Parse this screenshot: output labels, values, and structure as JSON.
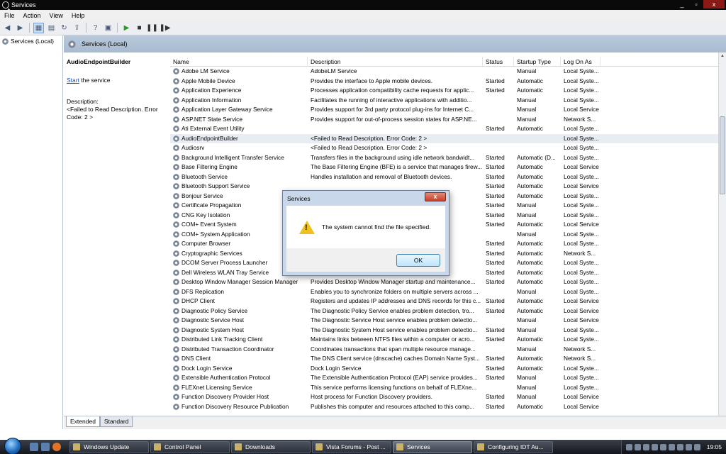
{
  "window": {
    "title": "Services",
    "controls": [
      "_",
      "▫",
      "x"
    ]
  },
  "menu": [
    "File",
    "Action",
    "View",
    "Help"
  ],
  "toolbar_icons": [
    "back-icon",
    "forward-icon",
    "console-tree-icon",
    "properties-icon",
    "refresh-icon",
    "export-icon",
    "help-icon",
    "console-icon",
    "play-icon",
    "stop-icon",
    "pause-icon",
    "restart-icon"
  ],
  "tree": {
    "root_label": "Services (Local)"
  },
  "panel": {
    "header": "Services (Local)"
  },
  "details": {
    "service_name": "AudioEndpointBuilder",
    "start_link": "Start",
    "start_suffix": " the service",
    "description_label": "Description:",
    "description_text": "<Failed to Read Description. Error Code: 2 >"
  },
  "columns": [
    "Name",
    "Description",
    "Status",
    "Startup Type",
    "Log On As"
  ],
  "services": [
    {
      "name": "Adobe LM Service",
      "desc": "AdobeLM Service",
      "status": "",
      "startup": "Manual",
      "logon": "Local Syste..."
    },
    {
      "name": "Apple Mobile Device",
      "desc": "Provides the interface to Apple mobile devices.",
      "status": "Started",
      "startup": "Automatic",
      "logon": "Local Syste..."
    },
    {
      "name": "Application Experience",
      "desc": "Processes application compatibility cache requests for applic...",
      "status": "Started",
      "startup": "Automatic",
      "logon": "Local Syste..."
    },
    {
      "name": "Application Information",
      "desc": "Facilitates the running of interactive applications with additio...",
      "status": "",
      "startup": "Manual",
      "logon": "Local Syste..."
    },
    {
      "name": "Application Layer Gateway Service",
      "desc": "Provides support for 3rd party protocol plug-ins for Internet C...",
      "status": "",
      "startup": "Manual",
      "logon": "Local Service"
    },
    {
      "name": "ASP.NET State Service",
      "desc": "Provides support for out-of-process session states for ASP.NE...",
      "status": "",
      "startup": "Manual",
      "logon": "Network S..."
    },
    {
      "name": "Ati External Event Utility",
      "desc": "",
      "status": "Started",
      "startup": "Automatic",
      "logon": "Local Syste..."
    },
    {
      "name": "AudioEndpointBuilder",
      "desc": "<Failed to Read Description. Error Code: 2 >",
      "status": "",
      "startup": "",
      "logon": "Local Syste..."
    },
    {
      "name": "Audiosrv",
      "desc": "<Failed to Read Description. Error Code: 2 >",
      "status": "",
      "startup": "",
      "logon": "Local Syste..."
    },
    {
      "name": "Background Intelligent Transfer Service",
      "desc": "Transfers files in the background using idle network bandwidt...",
      "status": "Started",
      "startup": "Automatic (D...",
      "logon": "Local Syste..."
    },
    {
      "name": "Base Filtering Engine",
      "desc": "The Base Filtering Engine (BFE) is a service that manages firew...",
      "status": "Started",
      "startup": "Automatic",
      "logon": "Local Service"
    },
    {
      "name": "Bluetooth Service",
      "desc": "Handles installation and removal of Bluetooth devices.",
      "status": "Started",
      "startup": "Automatic",
      "logon": "Local Syste..."
    },
    {
      "name": "Bluetooth Support Service",
      "desc": "",
      "status": "Started",
      "startup": "Automatic",
      "logon": "Local Service"
    },
    {
      "name": "Bonjour Service",
      "desc": "dvertise...",
      "status": "Started",
      "startup": "Automatic",
      "logon": "Local Syste..."
    },
    {
      "name": "Certificate Propagation",
      "desc": "",
      "status": "Started",
      "startup": "Manual",
      "logon": "Local Syste..."
    },
    {
      "name": "CNG Key Isolation",
      "desc": "ocess. Th...",
      "status": "Started",
      "startup": "Manual",
      "logon": "Local Syste..."
    },
    {
      "name": "COM+ Event System",
      "desc": "hich pro...",
      "status": "Started",
      "startup": "Automatic",
      "logon": "Local Service"
    },
    {
      "name": "COM+ System Application",
      "desc": "ent Obje...",
      "status": "",
      "startup": "Manual",
      "logon": "Local Syste..."
    },
    {
      "name": "Computer Browser",
      "desc": "rk and s...",
      "status": "Started",
      "startup": "Automatic",
      "logon": "Local Syste..."
    },
    {
      "name": "Cryptographic Services",
      "desc": "e Servic...",
      "status": "Started",
      "startup": "Automatic",
      "logon": "Network S..."
    },
    {
      "name": "DCOM Server Process Launcher",
      "desc": "",
      "status": "Started",
      "startup": "Automatic",
      "logon": "Local Syste..."
    },
    {
      "name": "Dell Wireless WLAN Tray Service",
      "desc": "er usin...",
      "status": "Started",
      "startup": "Automatic",
      "logon": "Local Syste..."
    },
    {
      "name": "Desktop Window Manager Session Manager",
      "desc": "Provides Desktop Window Manager startup and maintenance...",
      "status": "Started",
      "startup": "Automatic",
      "logon": "Local Syste..."
    },
    {
      "name": "DFS Replication",
      "desc": "Enables you to synchronize folders on multiple servers across ...",
      "status": "",
      "startup": "Manual",
      "logon": "Local Syste..."
    },
    {
      "name": "DHCP Client",
      "desc": "Registers and updates IP addresses and DNS records for this c...",
      "status": "Started",
      "startup": "Automatic",
      "logon": "Local Service"
    },
    {
      "name": "Diagnostic Policy Service",
      "desc": "The Diagnostic Policy Service enables problem detection, tro...",
      "status": "Started",
      "startup": "Automatic",
      "logon": "Local Service"
    },
    {
      "name": "Diagnostic Service Host",
      "desc": "The Diagnostic Service Host service enables problem detectio...",
      "status": "",
      "startup": "Manual",
      "logon": "Local Service"
    },
    {
      "name": "Diagnostic System Host",
      "desc": "The Diagnostic System Host service enables problem detectio...",
      "status": "Started",
      "startup": "Manual",
      "logon": "Local Syste..."
    },
    {
      "name": "Distributed Link Tracking Client",
      "desc": "Maintains links between NTFS files within a computer or acro...",
      "status": "Started",
      "startup": "Automatic",
      "logon": "Local Syste..."
    },
    {
      "name": "Distributed Transaction Coordinator",
      "desc": "Coordinates transactions that span multiple resource manage...",
      "status": "",
      "startup": "Manual",
      "logon": "Network S..."
    },
    {
      "name": "DNS Client",
      "desc": "The DNS Client service (dnscache) caches Domain Name Syst...",
      "status": "Started",
      "startup": "Automatic",
      "logon": "Network S..."
    },
    {
      "name": "Dock Login Service",
      "desc": "Dock Login Service",
      "status": "Started",
      "startup": "Automatic",
      "logon": "Local Syste..."
    },
    {
      "name": "Extensible Authentication Protocol",
      "desc": "The Extensible Authentication Protocol (EAP) service provides...",
      "status": "Started",
      "startup": "Manual",
      "logon": "Local Syste..."
    },
    {
      "name": "FLEXnet Licensing Service",
      "desc": "This service performs licensing functions on behalf of FLEXne...",
      "status": "",
      "startup": "Manual",
      "logon": "Local Syste..."
    },
    {
      "name": "Function Discovery Provider Host",
      "desc": "Host process for Function Discovery providers.",
      "status": "Started",
      "startup": "Manual",
      "logon": "Local Service"
    },
    {
      "name": "Function Discovery Resource Publication",
      "desc": "Publishes this computer and resources attached to this comp...",
      "status": "Started",
      "startup": "Automatic",
      "logon": "Local Service"
    }
  ],
  "selected_row": 7,
  "tabs": [
    "Extended",
    "Standard"
  ],
  "dialog": {
    "title": "Services",
    "message": "The system cannot find the file specified.",
    "ok_label": "OK",
    "close_label": "x"
  },
  "taskbar": {
    "tasks": [
      {
        "label": "Windows Update",
        "active": false
      },
      {
        "label": "Control Panel",
        "active": false
      },
      {
        "label": "Downloads",
        "active": false
      },
      {
        "label": "Vista Forums - Post ...",
        "active": false
      },
      {
        "label": "Services",
        "active": true
      },
      {
        "label": "Configuring IDT Au...",
        "active": false
      }
    ],
    "clock": "19:05"
  },
  "colors": {
    "panel_header": "#b9c9db",
    "selected_row": "#e8edf4",
    "link": "#1a4fc0",
    "warning": "#f0c020"
  }
}
